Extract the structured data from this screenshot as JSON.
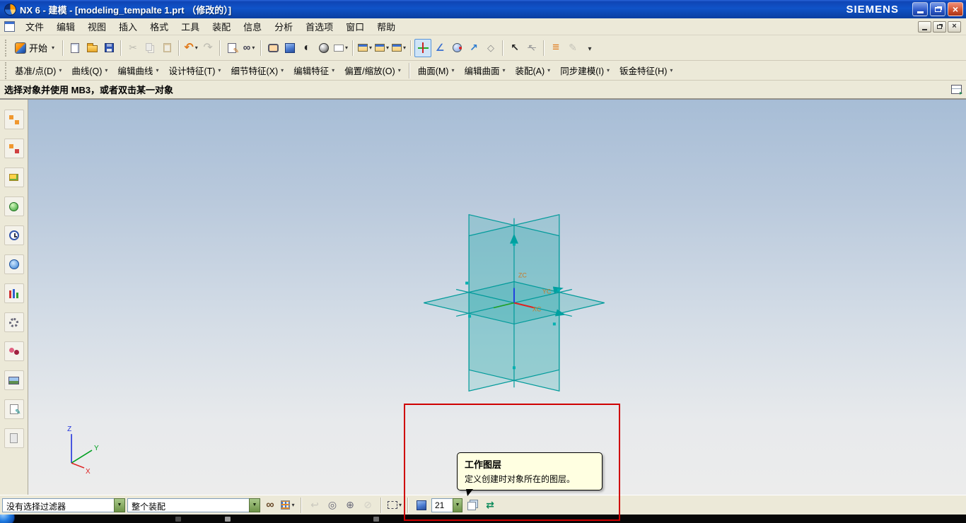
{
  "window": {
    "title": "NX 6 - 建模 - [modeling_tempalte 1.prt （修改的）]",
    "brand": "SIEMENS"
  },
  "menubar": {
    "items": [
      "文件",
      "编辑",
      "视图",
      "插入",
      "格式",
      "工具",
      "装配",
      "信息",
      "分析",
      "首选项",
      "窗口",
      "帮助"
    ]
  },
  "toolbar_standard": {
    "start_label": "开始",
    "icons": [
      "new-file",
      "open-file",
      "save-file",
      "cut",
      "copy",
      "paste",
      "undo",
      "redo",
      "info-window",
      "command-finder",
      "zoom-view",
      "shaded-view",
      "orient-view",
      "render-style",
      "background-color",
      "new-window",
      "cascade-windows",
      "tile-windows",
      "datum-csys",
      "angle-dimension",
      "point-on-face",
      "vector-arrows",
      "snap-point",
      "select-cursor",
      "deselect-cursor",
      "measure-distance",
      "sketch-pencil",
      "toolbar-overflow"
    ]
  },
  "toolbar_features": {
    "items": [
      "基准/点(D)",
      "曲线(Q)",
      "编辑曲线",
      "设计特征(T)",
      "细节特征(X)",
      "编辑特征",
      "偏置/缩放(O)",
      "曲面(M)",
      "编辑曲面",
      "装配(A)",
      "同步建模(I)",
      "钣金特征(H)"
    ]
  },
  "prompt_bar": {
    "message": "选择对象并使用 MB3，或者双击某一对象"
  },
  "sidebar": {
    "icons": [
      "assembly-navigator",
      "constraint-navigator",
      "part-navigator",
      "reuse-library",
      "history",
      "web-browser",
      "visual-reports",
      "machining-wizards",
      "roles",
      "scene-gallery",
      "templates",
      "documentation"
    ]
  },
  "viewport": {
    "triad": {
      "x": "X",
      "y": "Y",
      "z": "Z"
    },
    "csys": {
      "xc": "XC",
      "yc": "YC",
      "zc": "ZC"
    }
  },
  "bottom_bar": {
    "selection_filter": "没有选择过滤器",
    "selection_scope": "整个装配",
    "work_layer": "21",
    "icons": [
      "binoculars",
      "selection-grid",
      "undo-selection",
      "highlight-face",
      "snap-point",
      "clear-snap",
      "rectangle-select",
      "display-cube",
      "work-layer-input",
      "layer-visibility",
      "layer-category"
    ]
  },
  "tooltip": {
    "title": "工作图层",
    "body": "定义创建时对象所在的图层。"
  },
  "colors": {
    "datum_teal": "#00A0A0",
    "titlebar_blue": "#0D4FC4",
    "tooltip_bg": "#FFFFE1",
    "annotation_red": "#CF0000"
  }
}
